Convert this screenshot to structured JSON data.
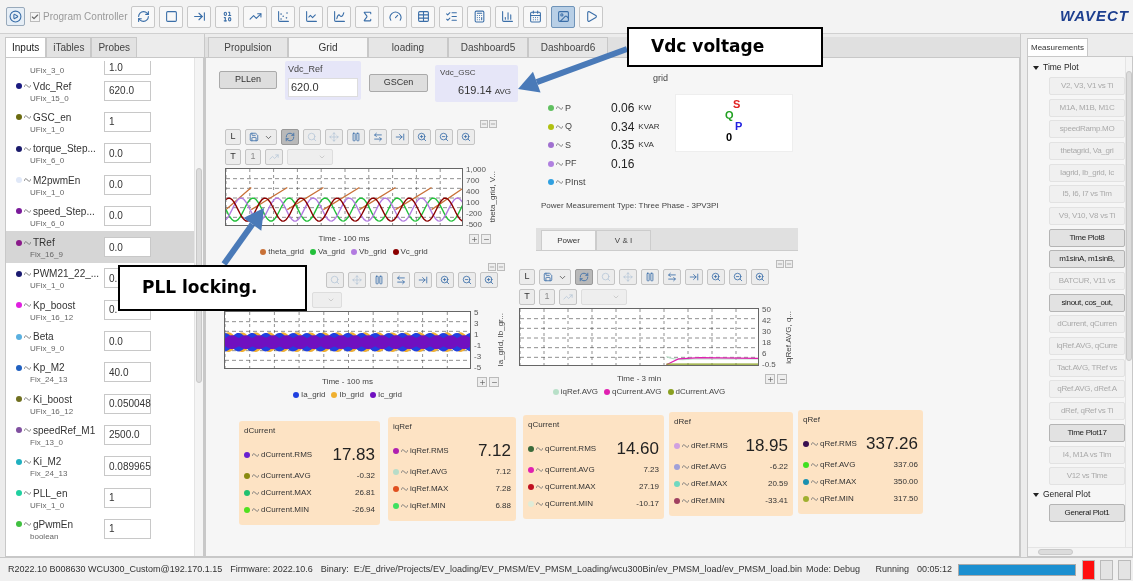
{
  "toolbar": {
    "program_controller": {
      "label": "Program Controller",
      "checked": true,
      "disabled": true
    },
    "buttons": [
      {
        "selected": false
      },
      {
        "selected": false
      },
      {
        "selected": false
      },
      {
        "selected": false
      },
      {
        "selected": false
      },
      {
        "selected": false
      },
      {
        "selected": false
      },
      {
        "selected": false
      },
      {
        "selected": false
      },
      {
        "selected": false
      },
      {
        "selected": false
      },
      {
        "selected": false
      },
      {
        "selected": false
      },
      {
        "selected": false
      },
      {
        "selected": false
      },
      {
        "selected": true
      },
      {
        "selected": false
      }
    ],
    "logo": "WAVECT"
  },
  "left_panel": {
    "tabs": [
      {
        "label": "Inputs",
        "selected": true
      },
      {
        "label": "iTables",
        "selected": false
      },
      {
        "label": "Probes",
        "selected": false
      }
    ],
    "inputs": [
      {
        "type": "UFix_3_0",
        "value": "1.0",
        "selected": false
      },
      {
        "name": "Vdc_Ref",
        "type": "UFix_15_0",
        "value": "620.0",
        "color": "#1a1a80",
        "selected": false
      },
      {
        "name": "GSC_en",
        "type": "UFix_1_0",
        "value": "1",
        "color": "#6b6b10",
        "selected": false
      },
      {
        "name": "torque_Step...",
        "type": "UFix_6_0",
        "value": "0.0",
        "color": "#1a1a6b",
        "selected": false
      },
      {
        "name": "M2pwmEn",
        "type": "UFix_1_0",
        "value": "0.0",
        "color": "#e0e8f8",
        "selected": false
      },
      {
        "name": "speed_Step...",
        "type": "UFix_6_0",
        "value": "0.0",
        "color": "#7a1a9a",
        "selected": false
      },
      {
        "name": "TRef",
        "type": "Fix_16_9",
        "value": "0.0",
        "color": "#8a1a8a",
        "selected": true
      },
      {
        "name": "PWM21_22_...",
        "type": "UFix_1_0",
        "value": "0.",
        "color": "#1a1a70",
        "selected": false
      },
      {
        "name": "Kp_boost",
        "type": "UFix_16_12",
        "value": "0.",
        "color": "#e020e0",
        "selected": false
      },
      {
        "name": "Beta",
        "type": "UFix_9_0",
        "value": "0.0",
        "color": "#5ab0e0",
        "selected": false
      },
      {
        "name": "Kp_M2",
        "type": "Fix_24_13",
        "value": "40.0",
        "color": "#2060c0",
        "selected": false
      },
      {
        "name": "Ki_boost",
        "type": "UFix_16_12",
        "value": "0.050048",
        "color": "#707020",
        "selected": false
      },
      {
        "name": "speedRef_M1",
        "type": "Fix_13_0",
        "value": "2500.0",
        "color": "#8050a0",
        "selected": false
      },
      {
        "name": "Ki_M2",
        "type": "Fix_24_13",
        "value": "0.089965",
        "color": "#20b0c0",
        "selected": false
      },
      {
        "name": "PLL_en",
        "type": "UFix_1_0",
        "value": "1",
        "color": "#20d0a0",
        "selected": false
      },
      {
        "name": "gPwmEn",
        "type": "boolean",
        "value": "1",
        "color": "#40c040",
        "selected": false
      }
    ]
  },
  "dashboard": {
    "tabs": [
      {
        "label": "Propulsion",
        "selected": false
      },
      {
        "label": "Grid",
        "selected": true
      },
      {
        "label": "loading",
        "selected": false
      },
      {
        "label": "Dashboard5",
        "selected": false
      },
      {
        "label": "Dashboard6",
        "selected": false
      }
    ],
    "pllen_button": "PLLen",
    "vdc_ref": {
      "label": "Vdc_Ref",
      "value": "620.0"
    },
    "gscen_button": "GSCen",
    "vdc_gsc": {
      "label": "Vdc_GSC",
      "value": "619.14",
      "unit": "AVG"
    },
    "power": {
      "title": "grid",
      "items": [
        {
          "name": "P",
          "value": "0.06",
          "unit": "KW",
          "color": "#60c060"
        },
        {
          "name": "Q",
          "value": "0.34",
          "unit": "KVAR",
          "color": "#b0c010"
        },
        {
          "name": "S",
          "value": "0.35",
          "unit": "KVA",
          "color": "#a070d0"
        },
        {
          "name": "PF",
          "value": "0.16",
          "color": "#b080e0"
        },
        {
          "name": "PInst",
          "color": "#30a0e0"
        }
      ],
      "phasor_labels": [
        {
          "text": "S",
          "color": "#e02020"
        },
        {
          "text": "Q",
          "color": "#20a020"
        },
        {
          "text": "P",
          "color": "#2020e0"
        },
        {
          "text": "0",
          "color": "#000000"
        }
      ],
      "measurement_type": "Power Measurement Type: Three Phase - 3PV3PI",
      "tabs": [
        {
          "label": "Power",
          "selected": true
        },
        {
          "label": "V & I",
          "selected": false
        }
      ]
    },
    "charts": [
      {
        "kind": "three_phase",
        "labels": {
          "l": "L",
          "t": "T",
          "one": "1"
        },
        "auto_refresh": true,
        "y_ticks": [
          "1,000",
          "700",
          "400",
          "100",
          "-200",
          "-500"
        ],
        "y_label": "theta_grid, V...",
        "x_label": "Time - 100 ms",
        "legend": [
          {
            "name": "theta_grid",
            "color": "#c87137"
          },
          {
            "name": "Va_grid",
            "color": "#22c03a"
          },
          {
            "name": "Vb_grid",
            "color": "#b27be0"
          },
          {
            "name": "Vc_grid",
            "color": "#8b0000"
          }
        ]
      },
      {
        "kind": "currents",
        "y_ticks": [
          "5",
          "3",
          "1",
          "-1",
          "-3",
          "-5"
        ],
        "y_label": "Ia_grid, Ib_gr...",
        "x_label": "Time - 100 ms",
        "legend": [
          {
            "name": "Ia_grid",
            "color": "#2040e0"
          },
          {
            "name": "Ib_grid",
            "color": "#f0b030"
          },
          {
            "name": "Ic_grid",
            "color": "#7010c0"
          }
        ]
      },
      {
        "kind": "trend",
        "labels": {
          "l": "L",
          "t": "T",
          "one": "1"
        },
        "auto_refresh": true,
        "y_ticks": [
          "50",
          "42",
          "30",
          "18",
          "6",
          "-0.5"
        ],
        "y_label": "iqRef.AVG, q...",
        "x_label": "Time - 3 min",
        "legend": [
          {
            "name": "iqRef.AVG",
            "color": "#b8e0c8"
          },
          {
            "name": "qCurrent.AVG",
            "color": "#e020b0"
          },
          {
            "name": "dCurrent.AVG",
            "color": "#8aa020"
          }
        ]
      }
    ],
    "cards": [
      {
        "title": "dCurrent",
        "rms": {
          "name": "dCurrent.RMS",
          "value": "17.83",
          "color": "#6a20d0"
        },
        "stats": [
          {
            "name": "dCurrent.AVG",
            "value": "-0.32",
            "color": "#8a8a10"
          },
          {
            "name": "dCurrent.MAX",
            "value": "26.81",
            "color": "#20c070"
          },
          {
            "name": "dCurrent.MIN",
            "value": "-26.94",
            "color": "#50e020"
          }
        ]
      },
      {
        "title": "iqRef",
        "rms": {
          "name": "iqRef.RMS",
          "value": "7.12",
          "color": "#b020b0"
        },
        "stats": [
          {
            "name": "iqRef.AVG",
            "value": "7.12",
            "color": "#b8dcc8"
          },
          {
            "name": "iqRef.MAX",
            "value": "7.28",
            "color": "#e05020"
          },
          {
            "name": "iqRef.MIN",
            "value": "6.88",
            "color": "#40e060"
          }
        ]
      },
      {
        "title": "qCurrent",
        "rms": {
          "name": "qCurrent.RMS",
          "value": "14.60",
          "color": "#3a6a3a"
        },
        "stats": [
          {
            "name": "qCurrent.AVG",
            "value": "7.23",
            "color": "#e020b0"
          },
          {
            "name": "qCurrent.MAX",
            "value": "27.19",
            "color": "#c01020"
          },
          {
            "name": "qCurrent.MIN",
            "value": "-10.17",
            "color": "#e0ecd8"
          }
        ]
      },
      {
        "title": "dRef",
        "rms": {
          "name": "dRef.RMS",
          "value": "18.95",
          "color": "#d0a0e0"
        },
        "stats": [
          {
            "name": "dRef.AVG",
            "value": "-6.22",
            "color": "#a0a0d8"
          },
          {
            "name": "dRef.MAX",
            "value": "20.59",
            "color": "#70d8c0"
          },
          {
            "name": "dRef.MIN",
            "value": "-33.41",
            "color": "#a04060"
          }
        ]
      },
      {
        "title": "qRef",
        "rms": {
          "name": "qRef.RMS",
          "value": "337.26",
          "color": "#3a1050"
        },
        "stats": [
          {
            "name": "qRef.AVG",
            "value": "337.06",
            "color": "#40e020"
          },
          {
            "name": "qRef.MAX",
            "value": "350.00",
            "color": "#1a90b0"
          },
          {
            "name": "qRef.MIN",
            "value": "317.50",
            "color": "#a0b030"
          }
        ]
      }
    ]
  },
  "right_panel": {
    "tab": "Measurements",
    "groups": [
      {
        "title": "Time Plot",
        "expanded": true,
        "items": [
          {
            "label": "V2, V3, V1 vs Ti",
            "enabled": false
          },
          {
            "label": "M1A, M1B, M1C",
            "enabled": false
          },
          {
            "label": "speedRamp.MO",
            "enabled": false
          },
          {
            "label": "thetagrid, Va_gri",
            "enabled": false
          },
          {
            "label": "Iagrid, Ib_grid, Ic",
            "enabled": false
          },
          {
            "label": "I5, I6, I7 vs Tim",
            "enabled": false
          },
          {
            "label": "V9, V10, V8 vs Ti",
            "enabled": false
          },
          {
            "label": "Time Plot8",
            "enabled": true
          },
          {
            "label": "m1sinA, m1sinB,",
            "enabled": true
          },
          {
            "label": "BATCUR, V11 vs",
            "enabled": false
          },
          {
            "label": "sinout, cos_out,",
            "enabled": true
          },
          {
            "label": "dCurrent, qCurren",
            "enabled": false
          },
          {
            "label": "iqRef.AVG, qCurre",
            "enabled": false
          },
          {
            "label": "Tact.AVG, TRef vs",
            "enabled": false
          },
          {
            "label": "qRef.AVG, dRef.A",
            "enabled": false
          },
          {
            "label": "dRef, qRef vs Ti",
            "enabled": false
          },
          {
            "label": "Time Plot17",
            "enabled": true
          },
          {
            "label": "I4, M1A vs Tim",
            "enabled": false
          },
          {
            "label": "V12 vs Time",
            "enabled": false
          }
        ]
      },
      {
        "title": "General Plot",
        "expanded": true,
        "items": [
          {
            "label": "General Plot1",
            "enabled": true
          }
        ]
      }
    ]
  },
  "status_bar": {
    "info": "R2022.10 B008630 WCU300_Custom@192.170.1.15",
    "firmware": "Firmware: 2022.10.6",
    "binary_label": "Binary:",
    "binary_path": "E:/E_drive/Projects/EV_loading/EV_PMSM/EV_PMSM_Loading/wcu300Bin/ev_PMSM_load/ev_PMSM_load.bin",
    "mode": "Mode: Debug",
    "state": "Running",
    "elapsed": "00:05:12",
    "progress": {
      "level": 1
    },
    "indicators": [
      {
        "color": "#ff1010"
      },
      {
        "color": "#e4e4e4"
      },
      {
        "color": "#e4e4e4"
      }
    ]
  },
  "annotations": [
    {
      "text": "Vdc voltage"
    },
    {
      "text": "PLL locking."
    }
  ]
}
